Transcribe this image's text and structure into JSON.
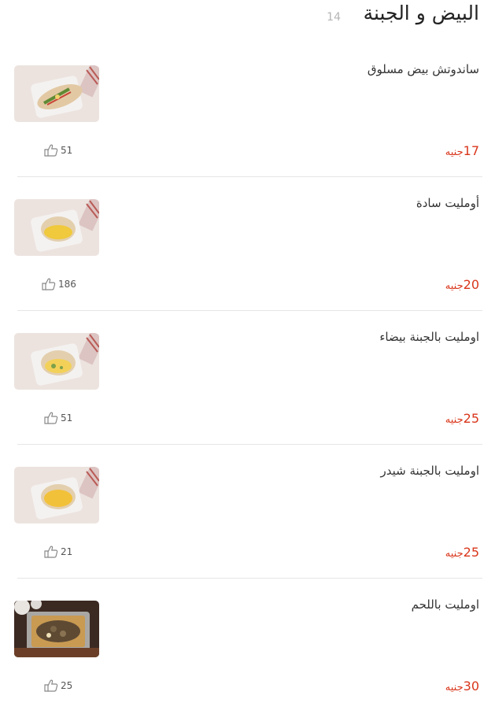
{
  "section": {
    "title": "البيض و الجبنة",
    "count": "14"
  },
  "currency": "جنيه",
  "items": [
    {
      "name": "ساندوتش بيض مسلوق",
      "price": "17",
      "likes": "51",
      "image": "egg-sandwich-photo"
    },
    {
      "name": "أومليت سادة",
      "price": "20",
      "likes": "186",
      "image": "plain-omelette-photo"
    },
    {
      "name": "اومليت بالجبنة بيضاء",
      "price": "25",
      "likes": "51",
      "image": "white-cheese-omelette-photo"
    },
    {
      "name": "اومليت بالجبنة شيدر",
      "price": "25",
      "likes": "21",
      "image": "cheddar-omelette-photo"
    },
    {
      "name": "اومليت باللحم",
      "price": "30",
      "likes": "25",
      "image": "meat-omelette-photo"
    }
  ],
  "colors": {
    "price": "#d9361b",
    "divider": "#e6e6e6",
    "count": "#b5b5b5"
  }
}
